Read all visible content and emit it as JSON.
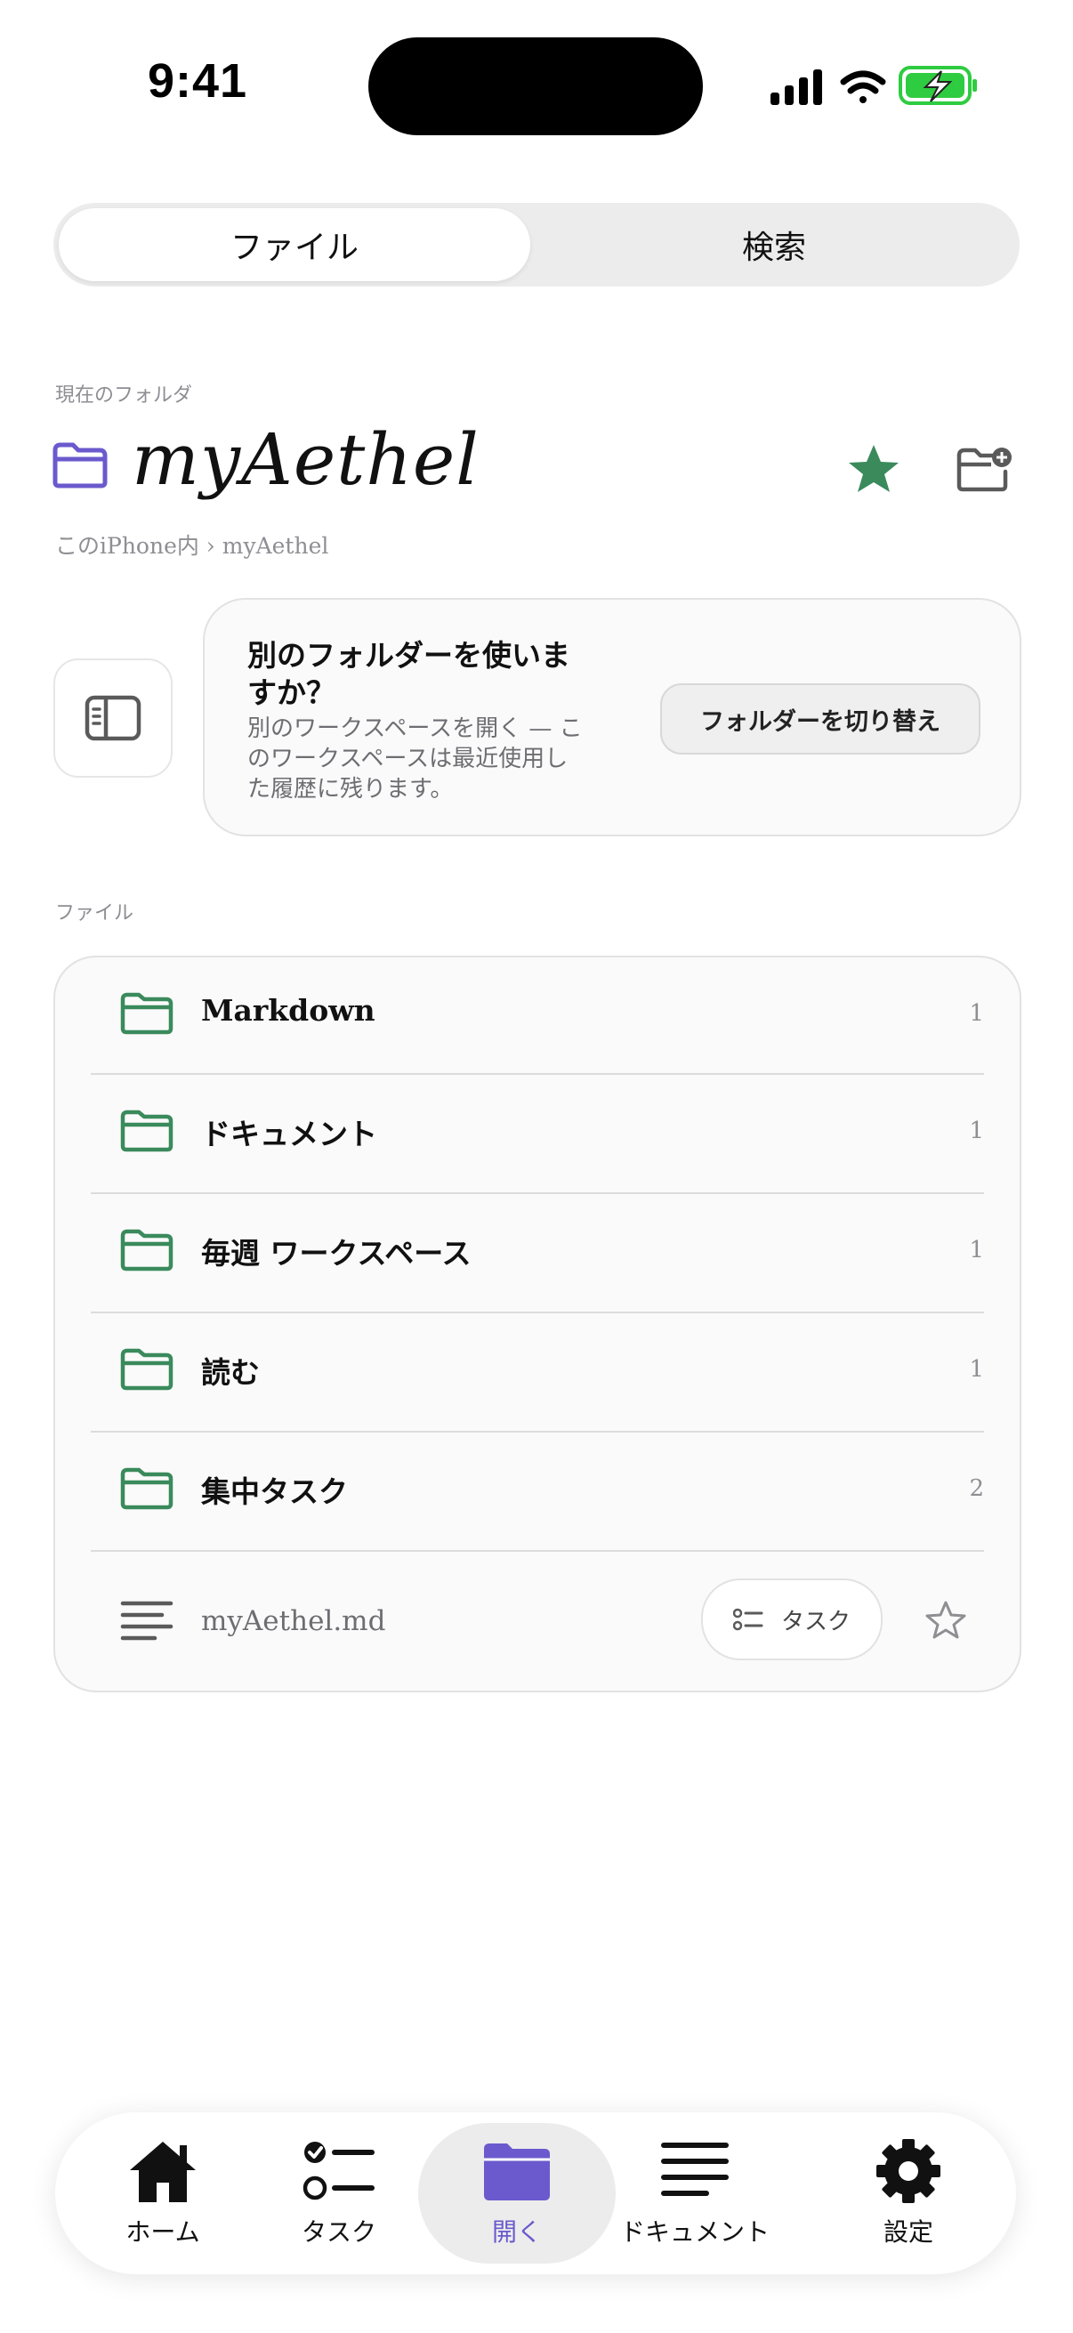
{
  "status": {
    "time": "9:41"
  },
  "segment": {
    "files": "ファイル",
    "search": "検索"
  },
  "current": {
    "section_label": "現在のフォルダ",
    "folder_name": "myAethel",
    "breadcrumb": "このiPhone内 › myAethel"
  },
  "workspace": {
    "title": "別のフォルダーを使いますか？",
    "description": "別のワークスペースを開く — このワークスペースは最近使用した履歴に残ります。",
    "switch_button": "フォルダーを切り替え"
  },
  "files": {
    "section_label": "ファイル",
    "folders": [
      {
        "name": "Markdown",
        "count": "1"
      },
      {
        "name": "ドキュメント",
        "count": "1"
      },
      {
        "name": "毎週 ワークスペース",
        "count": "1"
      },
      {
        "name": "読む",
        "count": "1"
      },
      {
        "name": "集中タスク",
        "count": "2"
      }
    ],
    "file": {
      "name": "myAethel.md",
      "task_chip": "タスク"
    }
  },
  "tabbar": {
    "items": [
      {
        "label": "ホーム",
        "icon": "house-icon"
      },
      {
        "label": "タスク",
        "icon": "checklist-icon"
      },
      {
        "label": "開く",
        "icon": "folder-icon",
        "active": true
      },
      {
        "label": "ドキュメント",
        "icon": "lines-icon"
      },
      {
        "label": "設定",
        "icon": "gear-icon"
      }
    ]
  },
  "colors": {
    "accent_purple": "#6a5acd",
    "green": "#3a8a5c",
    "icon_gray": "#5a5a5a"
  }
}
